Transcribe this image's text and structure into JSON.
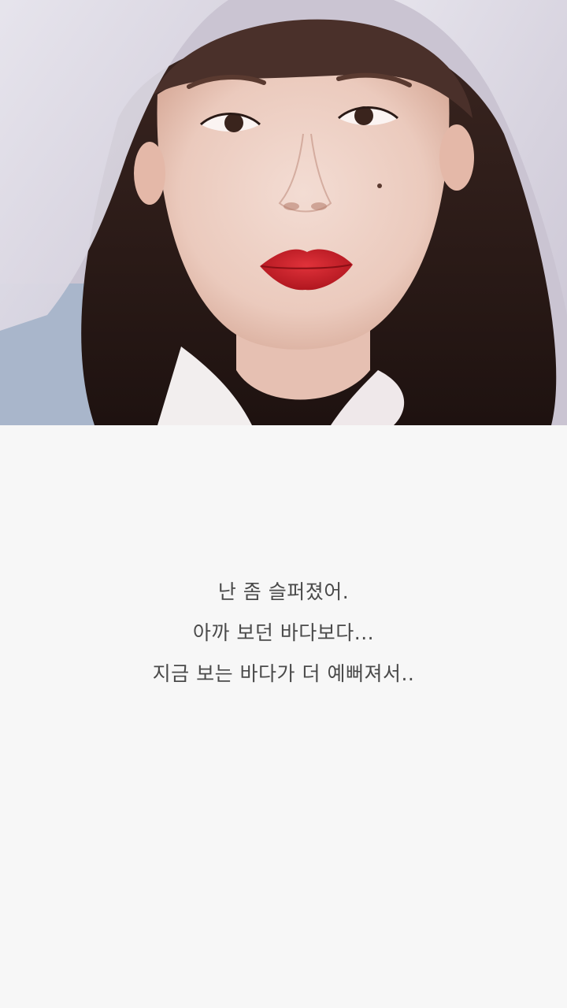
{
  "colors": {
    "background": "#f7f7f7",
    "text": "#4a4a4a",
    "lips": "#c8202a"
  },
  "photo": {
    "subject": "portrait-woman-white-veil"
  },
  "quote": {
    "lines": [
      "난 좀 슬퍼졌어.",
      "아까 보던 바다보다...",
      "지금 보는 바다가 더 예뻐져서.."
    ]
  }
}
